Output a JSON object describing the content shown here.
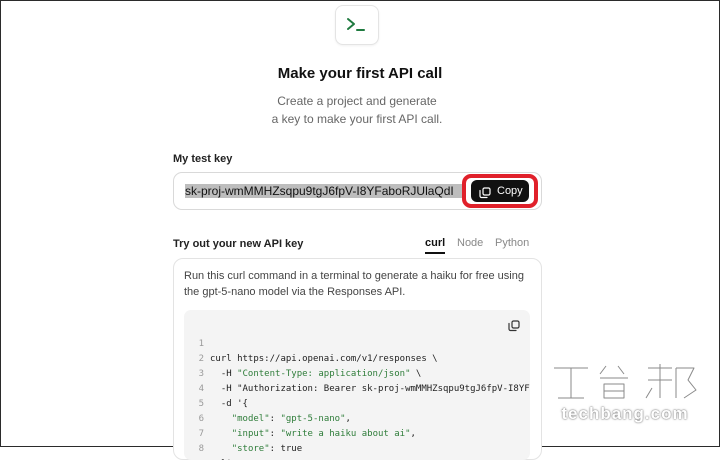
{
  "header": {
    "icon": "terminal-prompt-icon",
    "title": "Make your first API call",
    "subtitle_line1": "Create a project and generate",
    "subtitle_line2": "a key to make your first API call."
  },
  "test_key": {
    "label": "My test key",
    "value": "sk-proj-wmMMHZsqpu9tgJ6fpV-I8YFaboRJUlaQdI",
    "copy_label": "Copy",
    "copy_icon": "copy-icon",
    "highlight_color": "#e0202a"
  },
  "try_section": {
    "label": "Try out your new API key",
    "tabs": [
      {
        "label": "curl",
        "active": true
      },
      {
        "label": "Node",
        "active": false
      },
      {
        "label": "Python",
        "active": false
      }
    ],
    "description_line1": "Run this curl command in a terminal to generate a haiku for free using",
    "description_line2": "the gpt-5-nano model via the Responses API."
  },
  "code": {
    "lines": [
      {
        "n": "1",
        "text": "curl https://api.openai.com/v1/responses \\"
      },
      {
        "n": "2",
        "text": "  -H \"Content-Type: application/json\" \\"
      },
      {
        "n": "3",
        "text": "  -H \"Authorization: Bearer sk-proj-wmMMHZsqpu9tgJ6fpV-I8YF"
      },
      {
        "n": "4",
        "text": "  -d '{"
      },
      {
        "n": "5",
        "text": "    \"model\": \"gpt-5-nano\","
      },
      {
        "n": "6",
        "text": "    \"input\": \"write a haiku about ai\","
      },
      {
        "n": "7",
        "text": "    \"store\": true"
      },
      {
        "n": "8",
        "text": "  }'"
      }
    ]
  },
  "watermark": {
    "text": "techbang.com"
  }
}
